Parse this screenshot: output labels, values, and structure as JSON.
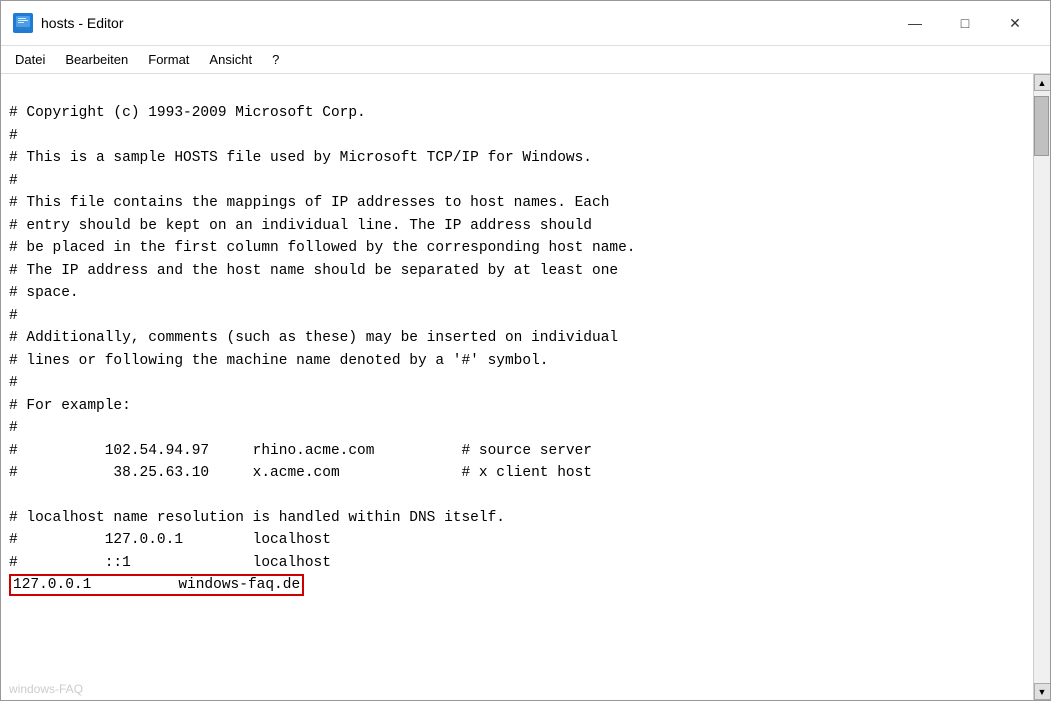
{
  "window": {
    "title": "hosts - Editor",
    "icon_label": "E"
  },
  "menu": {
    "items": [
      "Datei",
      "Bearbeiten",
      "Format",
      "Ansicht",
      "?"
    ]
  },
  "controls": {
    "minimize": "—",
    "maximize": "□",
    "close": "✕"
  },
  "content": {
    "lines": [
      "# Copyright (c) 1993-2009 Microsoft Corp.",
      "#",
      "# This is a sample HOSTS file used by Microsoft TCP/IP for Windows.",
      "#",
      "# This file contains the mappings of IP addresses to host names. Each",
      "# entry should be kept on an individual line. The IP address should",
      "# be placed in the first column followed by the corresponding host name.",
      "# The IP address and the host name should be separated by at least one",
      "# space.",
      "#",
      "# Additionally, comments (such as these) may be inserted on individual",
      "# lines or following the machine name denoted by a '#' symbol.",
      "#",
      "# For example:",
      "#",
      "#          102.54.94.97     rhino.acme.com          # source server",
      "#           38.25.63.10     x.acme.com              # x client host",
      "",
      "# localhost name resolution is handled within DNS itself.",
      "#          127.0.0.1        localhost",
      "#          ::1              localhost"
    ],
    "highlighted_line": "127.0.0.1          windows-faq.de",
    "watermark": "windows-FAQ"
  },
  "scrollbar": {
    "up_arrow": "▲",
    "down_arrow": "▼"
  }
}
